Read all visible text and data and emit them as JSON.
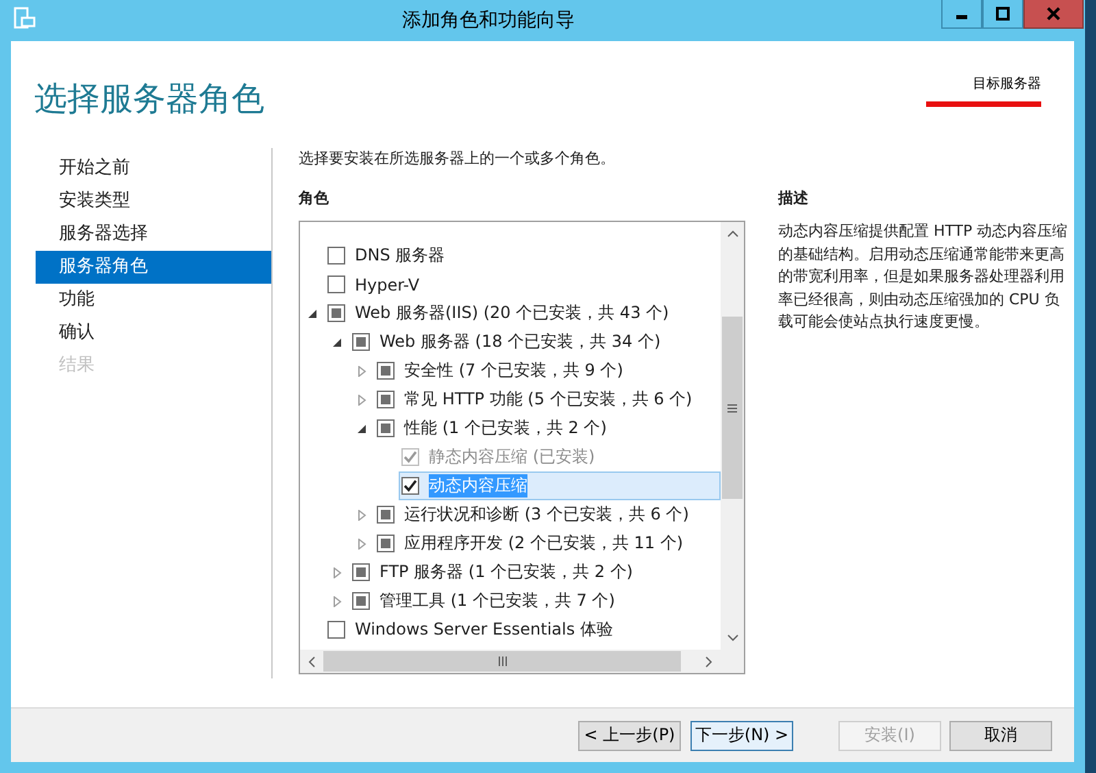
{
  "window": {
    "title": "添加角色和功能向导"
  },
  "page_title": "选择服务器角色",
  "target_server": {
    "label": "目标服务器"
  },
  "nav": [
    {
      "label": "开始之前",
      "selected": false,
      "disabled": false
    },
    {
      "label": "安装类型",
      "selected": false,
      "disabled": false
    },
    {
      "label": "服务器选择",
      "selected": false,
      "disabled": false
    },
    {
      "label": "服务器角色",
      "selected": true,
      "disabled": false
    },
    {
      "label": "功能",
      "selected": false,
      "disabled": false
    },
    {
      "label": "确认",
      "selected": false,
      "disabled": false
    },
    {
      "label": "结果",
      "selected": false,
      "disabled": true
    }
  ],
  "instruction": "选择要安装在所选服务器上的一个或多个角色。",
  "roles": {
    "heading": "角色",
    "items": [
      {
        "label": "DNS 服务器",
        "kind": "leaf",
        "checked": false,
        "partial": false,
        "disabled": false,
        "selected": false
      },
      {
        "label": "Hyper-V",
        "kind": "leaf",
        "checked": false,
        "partial": false,
        "disabled": false,
        "selected": false
      },
      {
        "label": "Web 服务器(IIS) (20 个已安装，共 43 个)",
        "kind": "folder",
        "expanded": true,
        "checked": false,
        "partial": true,
        "disabled": false,
        "selected": false,
        "children": [
          {
            "label": "Web 服务器 (18 个已安装，共 34 个)",
            "kind": "folder",
            "expanded": true,
            "checked": false,
            "partial": true,
            "disabled": false,
            "selected": false,
            "children": [
              {
                "label": "安全性 (7 个已安装，共 9 个)",
                "kind": "folder",
                "expanded": false,
                "checked": false,
                "partial": true,
                "disabled": false,
                "selected": false
              },
              {
                "label": "常见 HTTP 功能 (5 个已安装，共 6 个)",
                "kind": "folder",
                "expanded": false,
                "checked": false,
                "partial": true,
                "disabled": false,
                "selected": false
              },
              {
                "label": "性能 (1 个已安装，共 2 个)",
                "kind": "folder",
                "expanded": true,
                "checked": false,
                "partial": true,
                "disabled": false,
                "selected": false,
                "children": [
                  {
                    "label": "静态内容压缩 (已安装)",
                    "kind": "leaf",
                    "checked": true,
                    "partial": false,
                    "disabled": true,
                    "selected": false
                  },
                  {
                    "label": "动态内容压缩",
                    "kind": "leaf",
                    "checked": true,
                    "partial": false,
                    "disabled": false,
                    "selected": true
                  }
                ]
              },
              {
                "label": "运行状况和诊断 (3 个已安装，共 6 个)",
                "kind": "folder",
                "expanded": false,
                "checked": false,
                "partial": true,
                "disabled": false,
                "selected": false
              },
              {
                "label": "应用程序开发 (2 个已安装，共 11 个)",
                "kind": "folder",
                "expanded": false,
                "checked": false,
                "partial": true,
                "disabled": false,
                "selected": false
              }
            ]
          },
          {
            "label": "FTP 服务器 (1 个已安装，共 2 个)",
            "kind": "folder",
            "expanded": false,
            "checked": false,
            "partial": true,
            "disabled": false,
            "selected": false
          },
          {
            "label": "管理工具 (1 个已安装，共 7 个)",
            "kind": "folder",
            "expanded": false,
            "checked": false,
            "partial": true,
            "disabled": false,
            "selected": false
          }
        ]
      },
      {
        "label": "Windows Server Essentials 体验",
        "kind": "leaf",
        "checked": false,
        "partial": false,
        "disabled": false,
        "selected": false
      }
    ]
  },
  "description": {
    "heading": "描述",
    "text": "动态内容压缩提供配置 HTTP 动态内容压缩的基础结构。启用动态压缩通常能带来更高的带宽利用率，但是如果服务器处理器利用率已经很高，则由动态压缩强加的 CPU 负载可能会使站点执行速度更慢。"
  },
  "buttons": [
    {
      "label": "< 上一步(P)",
      "disabled": false,
      "focused": false
    },
    {
      "label": "下一步(N) >",
      "disabled": false,
      "focused": true
    },
    {
      "label": "安装(I)",
      "disabled": true,
      "focused": false
    },
    {
      "label": "取消",
      "disabled": false,
      "focused": false
    }
  ]
}
